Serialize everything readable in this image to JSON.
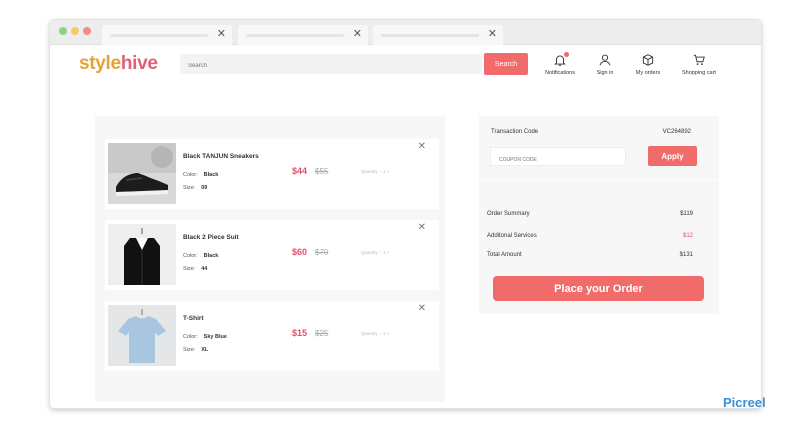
{
  "browser": {
    "tabs": [
      {
        "close": "✕"
      },
      {
        "close": "✕"
      },
      {
        "close": "✕"
      }
    ]
  },
  "header": {
    "logo_part1": "style",
    "logo_part2": "hive",
    "search_placeholder": "Search",
    "search_button": "Search",
    "nav": [
      {
        "icon": "bell-icon",
        "label": "Notifications"
      },
      {
        "icon": "user-icon",
        "label": "Sign in"
      },
      {
        "icon": "box-icon",
        "label": "My orders"
      },
      {
        "icon": "cart-icon",
        "label": "Shopping cart"
      }
    ]
  },
  "cart": {
    "items": [
      {
        "name": "Black TANJUN Sneakers",
        "color_label": "Color:",
        "color": "Black",
        "size_label": "Size:",
        "size": "09",
        "price": "$44",
        "old_price": "$55",
        "quantity": "Quantity  −  1  +"
      },
      {
        "name": "Black 2 Piece Suit",
        "color_label": "Color:",
        "color": "Black",
        "size_label": "Size:",
        "size": "44",
        "price": "$60",
        "old_price": "$70",
        "quantity": "Quantity  −  1  +"
      },
      {
        "name": "T-Shirt",
        "color_label": "Color:",
        "color": "Sky Blue",
        "size_label": "Size:",
        "size": "XL",
        "price": "$15",
        "old_price": "$25",
        "quantity": "Quantity  −  1  +"
      }
    ],
    "remove": "✕"
  },
  "summary": {
    "transaction_label": "Transaction Code",
    "transaction_code": "VC264892",
    "coupon_placeholder": "COUPON CODE",
    "apply": "Apply",
    "order_summary_label": "Order Summary",
    "order_summary_value": "$119",
    "services_label": "Additonal Services",
    "services_value": "$12",
    "total_label": "Total Amount",
    "total_value": "$131",
    "place_order": "Place your Order"
  },
  "colors": {
    "accent": "#f26b6b",
    "price": "#e0506a",
    "logo_orange": "#e8a233",
    "logo_pink": "#e0607a"
  },
  "watermark": "Picreel"
}
